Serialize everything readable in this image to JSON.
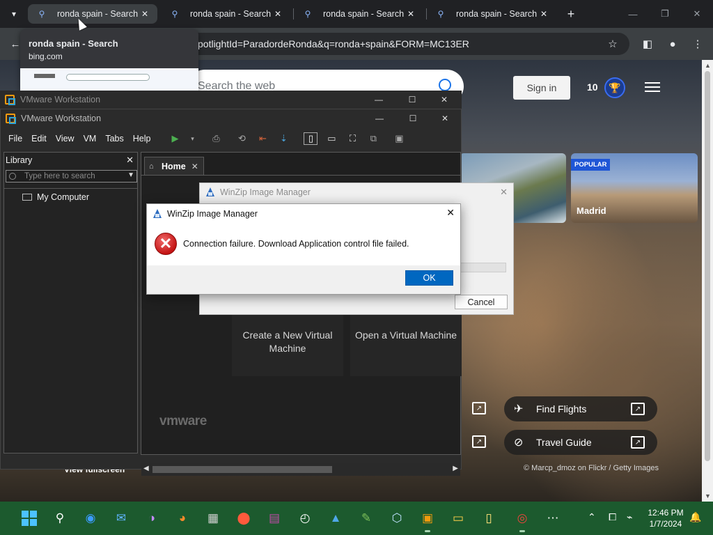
{
  "browser": {
    "tabs": [
      {
        "title": "ronda spain - Search"
      },
      {
        "title": "ronda spain - Search"
      },
      {
        "title": "ronda spain - Search"
      },
      {
        "title": "ronda spain - Search"
      }
    ],
    "url_visible": "potlightId=ParadordeRonda&q=ronda+spain&FORM=MC13ER",
    "hover_card": {
      "title": "ronda spain - Search",
      "domain": "bing.com"
    }
  },
  "bing": {
    "search_placeholder": "Search the web",
    "signin_label": "Sign in",
    "rewards_points": "10",
    "cards": [
      {
        "name": "",
        "badge": ""
      },
      {
        "name": "Madrid",
        "badge": "POPULAR"
      }
    ],
    "links": [
      {
        "label": "Find Flights"
      },
      {
        "label": "Travel Guide"
      }
    ],
    "credit": "© Marcp_dmoz on Flickr / Getty Images",
    "view_fullscreen": "View fullscreen"
  },
  "vmware": {
    "title_back": "VMware Workstation",
    "title": "VMware Workstation",
    "menu": [
      "File",
      "Edit",
      "View",
      "VM",
      "Tabs",
      "Help"
    ],
    "library": {
      "title": "Library",
      "search_placeholder": "Type here to search",
      "items": [
        "My Computer"
      ]
    },
    "home_tab": "Home",
    "tiles": [
      "Create a New Virtual Machine",
      "Open a Virtual Machine"
    ],
    "brand": "vmware"
  },
  "winzip_progress": {
    "title": "WinZip Image Manager",
    "cancel_label": "Cancel"
  },
  "winzip_error": {
    "title": "WinZip Image Manager",
    "message": "Connection failure. Download Application control file failed.",
    "ok_label": "OK"
  },
  "taskbar": {
    "time": "12:46 PM",
    "date": "1/7/2024"
  },
  "colors": {
    "chrome_bg": "#202124",
    "active_tab": "#3c4043",
    "taskbar": "#1c5a2e",
    "ok_button": "#0067c0",
    "error_red": "#c41414"
  }
}
